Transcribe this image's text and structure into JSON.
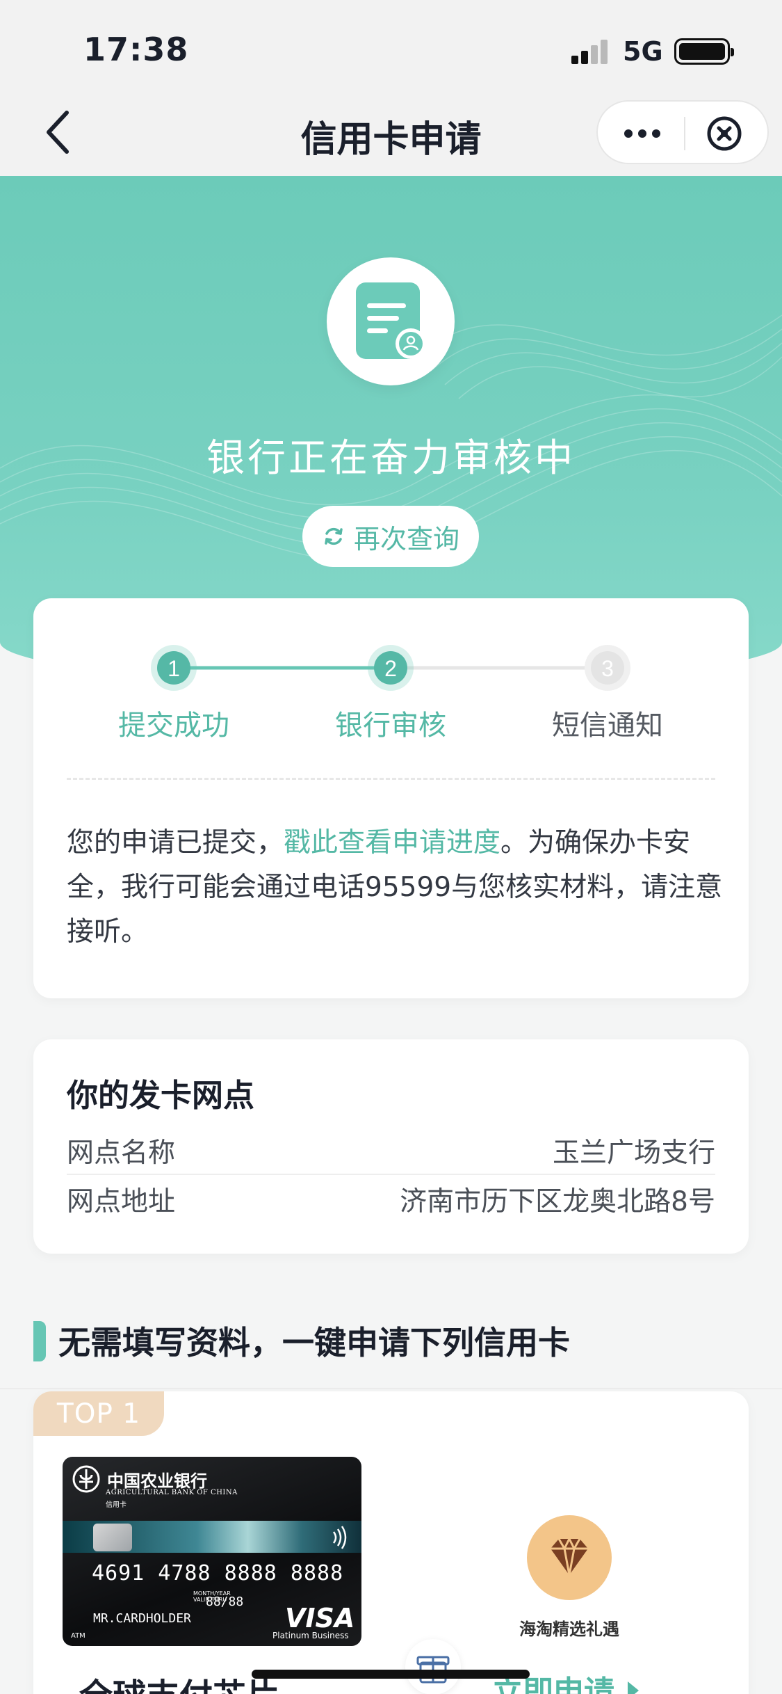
{
  "status_bar": {
    "time": "17:38",
    "network": "5G"
  },
  "nav": {
    "title": "信用卡申请"
  },
  "hero": {
    "title": "银行正在奋力审核中",
    "requery_label": "再次查询"
  },
  "progress": {
    "steps": [
      {
        "number": "1",
        "label": "提交成功",
        "state": "done"
      },
      {
        "number": "2",
        "label": "银行审核",
        "state": "current"
      },
      {
        "number": "3",
        "label": "短信通知",
        "state": "pending"
      }
    ],
    "notice_prefix": "您的申请已提交，",
    "notice_link": "戳此查看申请进度",
    "notice_suffix": "。为确保办卡安全，我行可能会通过电话95599与您核实材料，请注意接听。"
  },
  "branch": {
    "title": "你的发卡网点",
    "rows": [
      {
        "label": "网点名称",
        "value": "玉兰广场支行"
      },
      {
        "label": "网点地址",
        "value": "济南市历下区龙奥北路8号"
      }
    ]
  },
  "section": {
    "title": "无需填写资料，一键申请下列信用卡"
  },
  "offer": {
    "badge": "TOP 1",
    "card": {
      "bank_name": "中国农业银行",
      "bank_en": "AGRICULTURAL BANK OF CHINA",
      "bank_sub": "信用卡",
      "number": "4691 4788 8888 8888",
      "valid_label": "MONTH/YEAR",
      "valid_thru": "VALID THRU",
      "expiry": "88/88",
      "holder": "MR.CARDHOLDER",
      "network": "VISA",
      "network_sub": "Platinum Business",
      "atm": "ATM"
    },
    "perk_label": "海淘精选礼遇",
    "card_name": "全球支付芯片",
    "apply_label": "立即申请"
  },
  "colors": {
    "accent": "#54b8a5",
    "hero": "#6ccbb9",
    "badge": "#f0d9bf",
    "perk": "#f3c589"
  }
}
